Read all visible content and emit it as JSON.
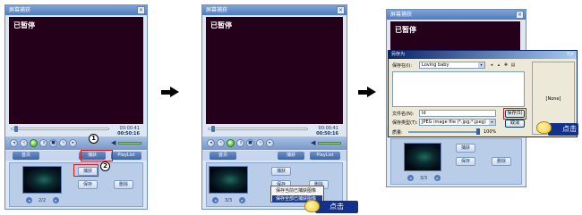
{
  "colors": {
    "accent": "#4f7cc0",
    "video_bg": "#24001a",
    "highlight_box": "#d61a1a",
    "callout_bg": "#13318a"
  },
  "player": {
    "title": "屏幕捕获",
    "status": "已暂停",
    "time_current": "00:00:41",
    "time_total": "00:50:16",
    "seek_progress": 0.06,
    "capture_label": "捕获",
    "tab_home": "首页",
    "tab_playlist": "PlayList",
    "thumbs_page": "2/2",
    "btn_capture": "捕获",
    "btn_save": "保存",
    "btn_delete": "删除"
  },
  "steps": {
    "one": "1",
    "two": "2"
  },
  "context_menu": {
    "items": [
      "保存当前已捕获图像",
      "保存全部已捕获图像"
    ],
    "highlighted": 1
  },
  "panel3": {
    "time_current": "00:00:41",
    "time_total": "00:50:16",
    "thumbs_page": "3/3"
  },
  "save_dialog": {
    "title": "另存为",
    "save_in_label": "保存在(I):",
    "save_in_value": "Loving baby",
    "filename_label": "文件名(N):",
    "filename_value": "ld",
    "filetype_label": "保存类型(T):",
    "filetype_value": "JPEG image file (*.jpg;*.jpeg)",
    "save_button": "保存(S)",
    "cancel_button": "取消",
    "quality_label": "质量:",
    "quality_value": "100%",
    "preview_text": "[None]",
    "help_icons": "?|×"
  },
  "callout": {
    "click_label": "点击"
  },
  "icons": [
    "play-icon",
    "pause-icon",
    "stop-icon",
    "prev-icon",
    "next-icon",
    "volume-icon",
    "arrow-right-icon",
    "pointing-hand-icon",
    "folder-up-icon",
    "new-folder-icon",
    "view-menu-icon"
  ]
}
